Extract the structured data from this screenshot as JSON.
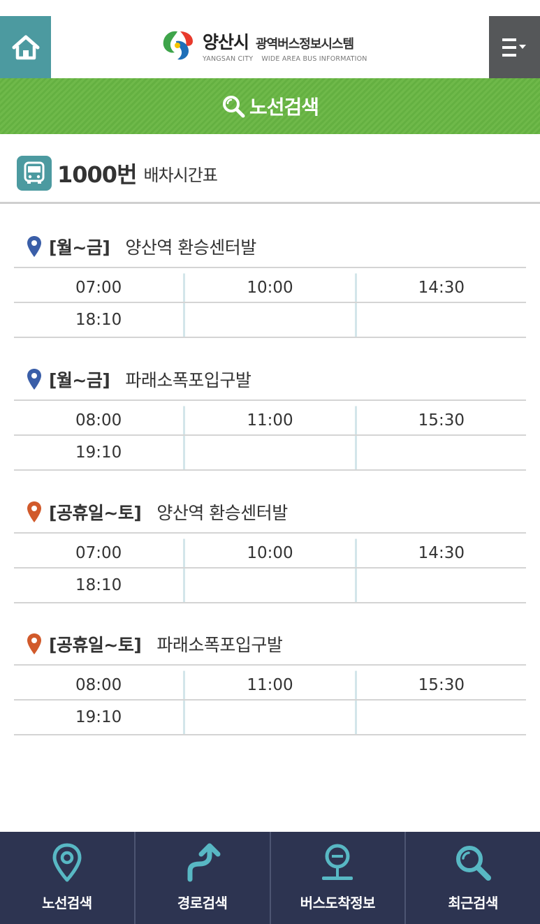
{
  "header": {
    "city_ko": "양산시",
    "system_ko": "광역버스정보시스템",
    "city_en": "YANGSAN CITY",
    "system_en": "WIDE AREA BUS INFORMATION",
    "home_icon": "home-icon",
    "menu_icon": "menu-icon"
  },
  "titlebar": {
    "title": "노선검색",
    "icon": "search-icon"
  },
  "route": {
    "number": "1000번",
    "subtitle": "배차시간표",
    "icon": "bus-icon"
  },
  "colors": {
    "teal": "#4c9aa0",
    "green": "#6fb94a",
    "navy": "#2d3451",
    "pin_blue": "#3a5ea8",
    "pin_orange": "#d15a2b"
  },
  "sections": [
    {
      "day": "[월~금]",
      "stop": "양산역 환승센터발",
      "pin_color": "#3a5ea8",
      "rows": [
        [
          "07:00",
          "10:00",
          "14:30"
        ],
        [
          "18:10",
          "",
          ""
        ]
      ]
    },
    {
      "day": "[월~금]",
      "stop": "파래소폭포입구발",
      "pin_color": "#3a5ea8",
      "rows": [
        [
          "08:00",
          "11:00",
          "15:30"
        ],
        [
          "19:10",
          "",
          ""
        ]
      ]
    },
    {
      "day": "[공휴일~토]",
      "stop": "양산역 환승센터발",
      "pin_color": "#d15a2b",
      "rows": [
        [
          "07:00",
          "10:00",
          "14:30"
        ],
        [
          "18:10",
          "",
          ""
        ]
      ]
    },
    {
      "day": "[공휴일~토]",
      "stop": "파래소폭포입구발",
      "pin_color": "#d15a2b",
      "rows": [
        [
          "08:00",
          "11:00",
          "15:30"
        ],
        [
          "19:10",
          "",
          ""
        ]
      ]
    }
  ],
  "nav": [
    {
      "label": "노선검색",
      "icon": "location-pin-icon"
    },
    {
      "label": "경로검색",
      "icon": "route-arrow-icon"
    },
    {
      "label": "버스도착정보",
      "icon": "bus-stop-icon"
    },
    {
      "label": "최근검색",
      "icon": "search-icon"
    }
  ]
}
